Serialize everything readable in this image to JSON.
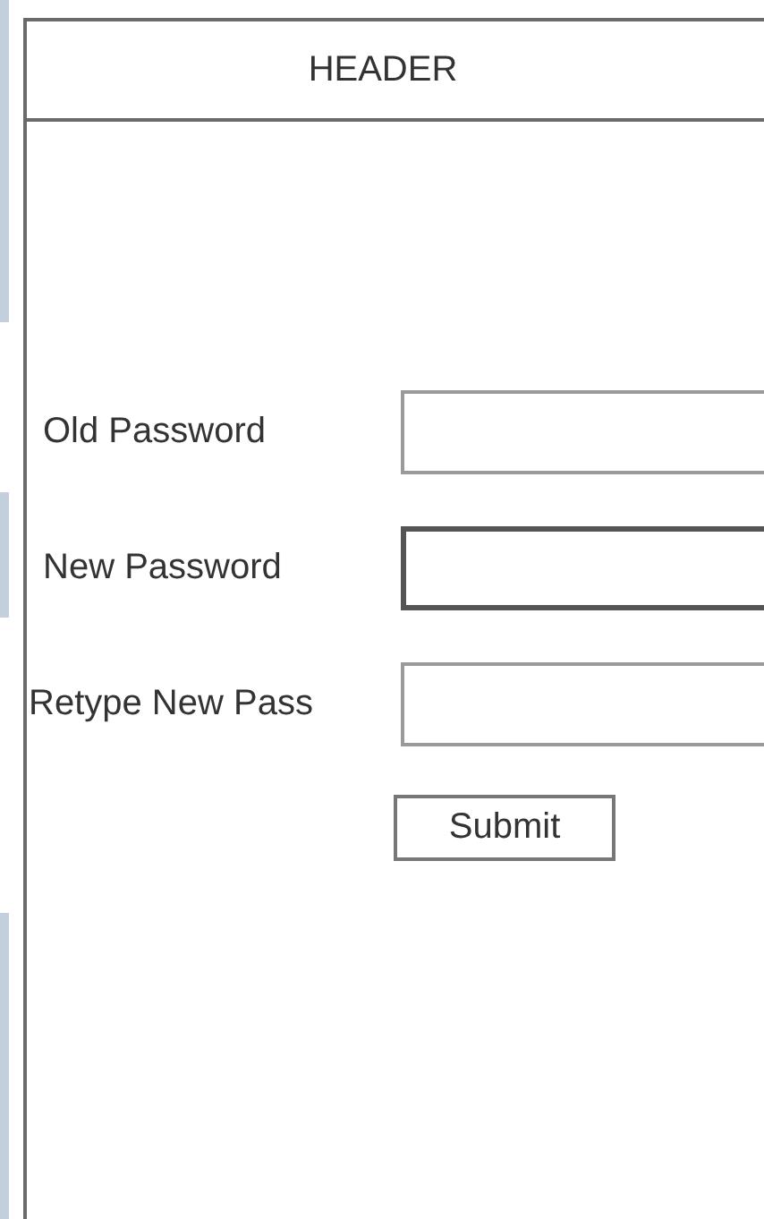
{
  "header": {
    "title": "HEADER"
  },
  "fields": [
    {
      "label": "Old Password",
      "focused": false
    },
    {
      "label": "New Password",
      "focused": true
    },
    {
      "label": "Retype New Pass",
      "focused": false
    }
  ],
  "submit_button": {
    "label": "Submit"
  }
}
